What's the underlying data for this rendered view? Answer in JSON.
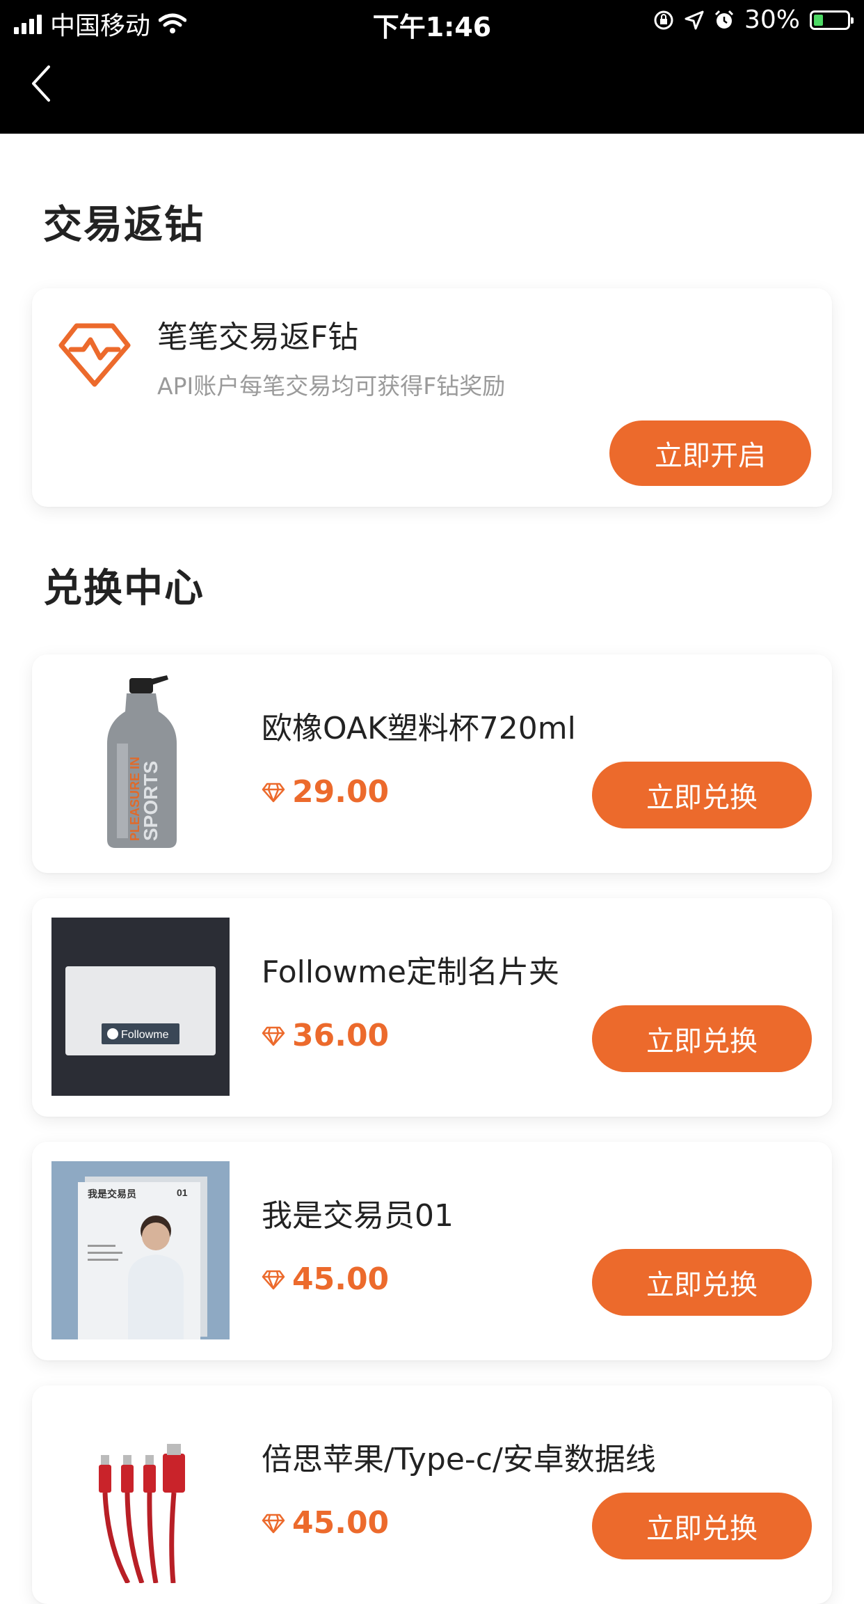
{
  "status_bar": {
    "carrier": "中国移动",
    "time": "下午1:46",
    "battery": "30%",
    "icons": [
      "signal-icon",
      "wifi-icon",
      "lock-rotation-icon",
      "location-icon",
      "alarm-icon",
      "battery-icon"
    ]
  },
  "nav": {
    "back_icon": "chevron-left-icon"
  },
  "sections": {
    "rebate_title": "交易返钻",
    "exchange_title": "兑换中心"
  },
  "promo": {
    "icon": "diamond-pulse-icon",
    "title": "笔笔交易返F钻",
    "subtitle": "API账户每笔交易均可获得F钻奖励",
    "button": "立即开启"
  },
  "products": [
    {
      "name": "欧橡OAK塑料杯720ml",
      "price": "29.00",
      "button": "立即兑换",
      "image": "water-bottle"
    },
    {
      "name": "Followme定制名片夹",
      "price": "36.00",
      "button": "立即兑换",
      "image": "card-holder"
    },
    {
      "name": "我是交易员01",
      "price": "45.00",
      "button": "立即兑换",
      "image": "magazine"
    },
    {
      "name": "倍思苹果/Type-c/安卓数据线",
      "price": "45.00",
      "button": "立即兑换",
      "image": "usb-cable"
    }
  ],
  "colors": {
    "accent": "#ec6a2c",
    "background": "#ffffff",
    "topbar": "#000000"
  }
}
